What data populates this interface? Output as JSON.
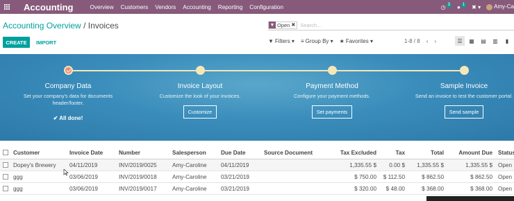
{
  "navbar": {
    "brand": "Accounting",
    "menu": [
      "Overview",
      "Customers",
      "Vendors",
      "Accounting",
      "Reporting",
      "Configuration"
    ],
    "activity_count": "3",
    "message_count": "1",
    "user": "Amy-Ca"
  },
  "breadcrumb": {
    "parent": "Accounting Overview",
    "separator": "/",
    "current": "Invoices"
  },
  "search": {
    "facet": "Open",
    "placeholder": "Search..."
  },
  "actions": {
    "create": "CREATE",
    "import": "IMPORT"
  },
  "filters": {
    "filters": "Filters",
    "group_by": "Group By",
    "favorites": "Favorites"
  },
  "pager": {
    "value": "1-8 / 8"
  },
  "banner": {
    "steps": [
      {
        "title": "Company Data",
        "desc": "Set your company's data for documents header/footer.",
        "done": "All done!"
      },
      {
        "title": "Invoice Layout",
        "desc": "Customize the look of your invoices.",
        "button": "Customize"
      },
      {
        "title": "Payment Method",
        "desc": "Configure your payment methods.",
        "button": "Set payments"
      },
      {
        "title": "Sample Invoice",
        "desc": "Send an invoice to test the customer portal.",
        "button": "Send sample"
      }
    ]
  },
  "table": {
    "headers": [
      "Customer",
      "Invoice Date",
      "Number",
      "Salesperson",
      "Due Date",
      "Source Document",
      "Tax Excluded",
      "Tax",
      "Total",
      "Amount Due",
      "Status"
    ],
    "rows": [
      {
        "customer": "Dopey's Brewery",
        "date": "04/11/2019",
        "number": "INV/2019/0025",
        "sales": "Amy-Caroline",
        "due": "04/11/2019",
        "source": "",
        "taxex": "1,335.55 $",
        "tax": "0.00 $",
        "total": "1,335.55 $",
        "amount": "1,335.55 $",
        "status": "Open"
      },
      {
        "customer": "ggg",
        "date": "03/06/2019",
        "number": "INV/2019/0018",
        "sales": "Amy-Caroline",
        "due": "03/21/2019",
        "source": "",
        "taxex": "$ 750.00",
        "tax": "$ 112.50",
        "total": "$ 862.50",
        "amount": "$ 862.50",
        "status": "Open"
      },
      {
        "customer": "ggg",
        "date": "03/06/2019",
        "number": "INV/2019/0017",
        "sales": "Amy-Caroline",
        "due": "03/21/2019",
        "source": "",
        "taxex": "$ 320.00",
        "tax": "$ 48.00",
        "total": "$ 368.00",
        "amount": "$ 368.00",
        "status": "Open"
      }
    ]
  }
}
